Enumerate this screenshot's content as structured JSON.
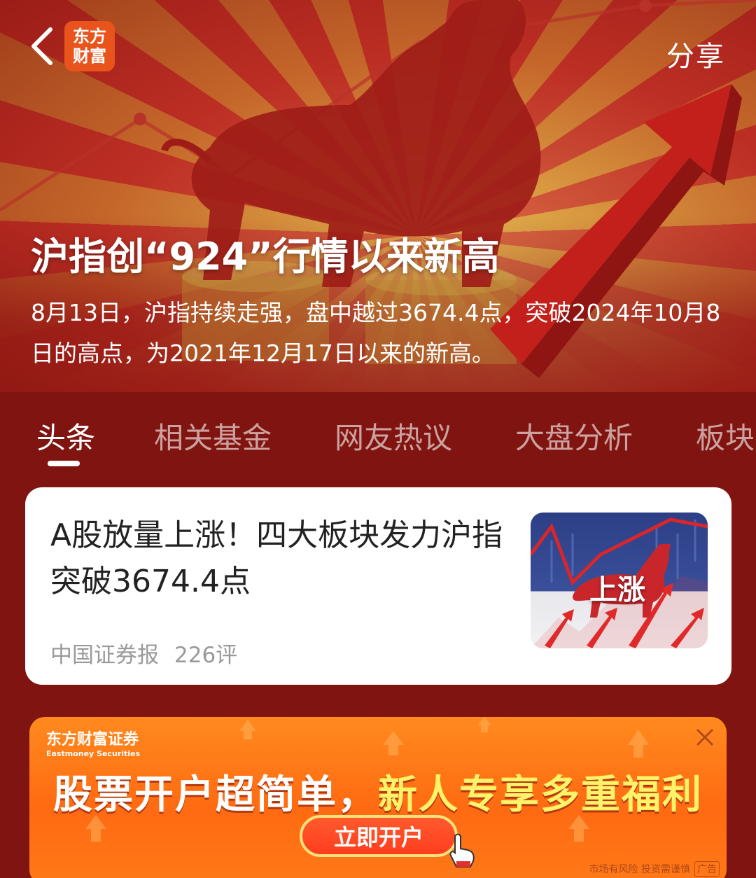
{
  "header": {
    "back_icon": "chevron-left-icon",
    "logo_text": "东方财富",
    "share_label": "分享"
  },
  "topic": {
    "title": "沪指创“924”行情以来新高",
    "description": "8月13日，沪指持续走强，盘中越过3674.4点，突破2024年10月8日的高点，为2021年12月17日以来的新高。"
  },
  "tabs": [
    {
      "label": "头条",
      "active": true
    },
    {
      "label": "相关基金",
      "active": false
    },
    {
      "label": "网友热议",
      "active": false
    },
    {
      "label": "大盘分析",
      "active": false
    },
    {
      "label": "板块",
      "active": false
    }
  ],
  "news": [
    {
      "title": "A股放量上涨！四大板块发力沪指突破3674.4点",
      "source": "中国证券报",
      "comments": "226评",
      "thumbnail_text": "上涨"
    }
  ],
  "ad": {
    "brand_cn": "东方财富证券",
    "brand_en": "Eastmoney Securities",
    "headline_part1": "股票开户超简单，",
    "headline_part2": "新人专享多重福利",
    "cta_label": "立即开户",
    "risk_notice": "市场有风险 投资需谨慎",
    "ad_tag": "广告",
    "close_icon": "close-icon"
  },
  "colors": {
    "background": "#7f1410",
    "accent_orange": "#ff6a12",
    "logo_orange": "#e8541c",
    "text_white": "#ffffff",
    "meta_gray": "#9a9a9a"
  }
}
